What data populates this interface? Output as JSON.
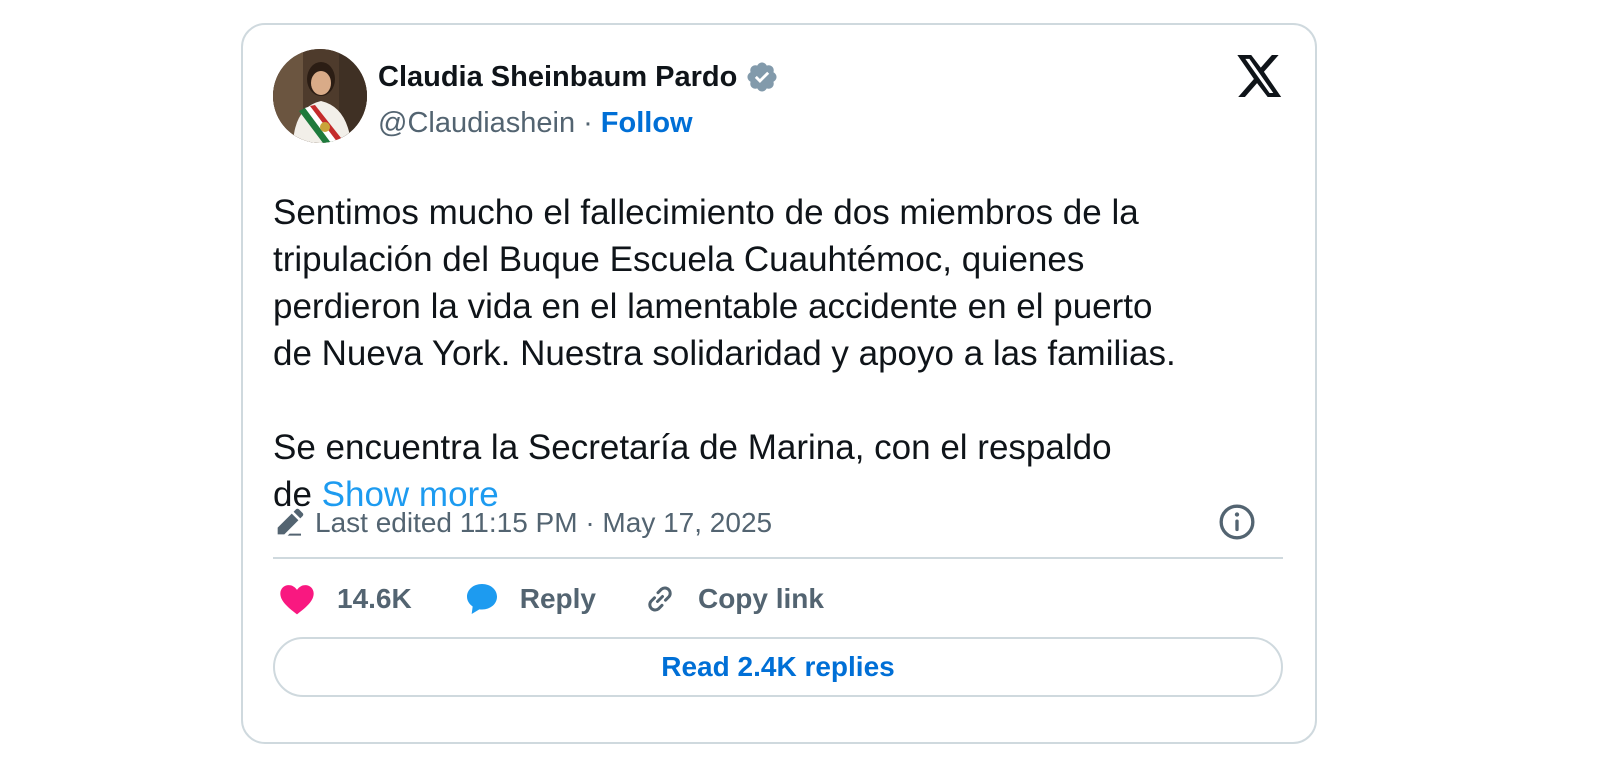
{
  "author": {
    "name": "Claudia Sheinbaum Pardo",
    "handle": "@Claudiashein",
    "separator": "·",
    "follow_label": "Follow",
    "verified": true
  },
  "tweet": {
    "lines_para1": [
      "Sentimos mucho el fallecimiento de dos miembros de la",
      "tripulación del Buque Escuela Cuauhtémoc, quienes",
      "perdieron la vida en el lamentable accidente en el puerto",
      "de Nueva York. Nuestra solidaridad y apoyo a las familias."
    ],
    "lines_para2": [
      "Se encuentra la Secretaría de Marina, con el respaldo"
    ],
    "last_line_prefix": "de ",
    "show_more_label": "Show more"
  },
  "meta": {
    "edited_label": "Last edited 11:15 PM · May 17, 2025"
  },
  "actions": {
    "likes_count": "14.6K",
    "reply_label": "Reply",
    "copy_link_label": "Copy link",
    "read_replies_label": "Read 2.4K replies"
  },
  "icons": {
    "brand": "x-logo-icon",
    "verified": "verified-badge-icon",
    "edited": "pencil-icon",
    "info": "info-icon",
    "like": "heart-icon",
    "reply": "speech-bubble-icon",
    "copy": "link-icon"
  },
  "colors": {
    "text": "#0f1419",
    "secondary": "#536471",
    "link": "#006fd6",
    "show_more": "#1d9bf0",
    "heart": "#f91880",
    "reply_bubble": "#1d9bf0",
    "verified": "#829aab",
    "border": "#cfd9de"
  }
}
